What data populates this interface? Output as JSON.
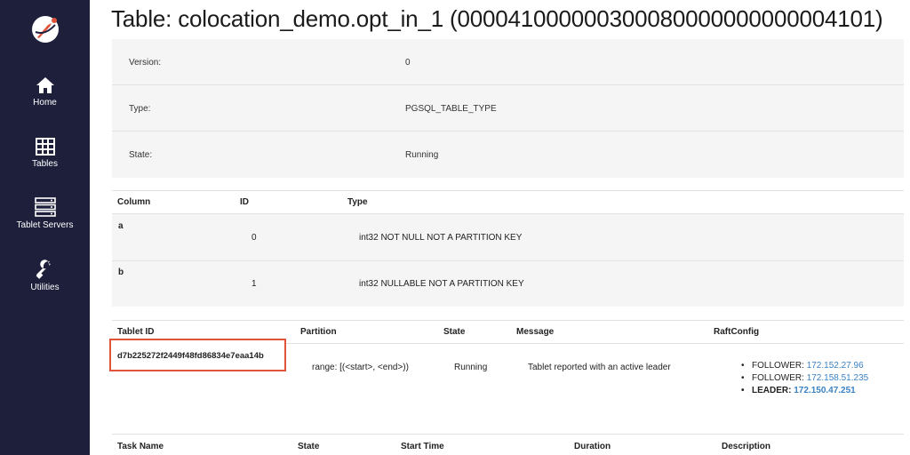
{
  "sidebar": {
    "logo_icon": "rocket-logo",
    "items": [
      {
        "label": "Home",
        "icon": "home-icon"
      },
      {
        "label": "Tables",
        "icon": "table-grid-icon"
      },
      {
        "label": "Tablet Servers",
        "icon": "server-rack-icon"
      },
      {
        "label": "Utilities",
        "icon": "wrench-icon"
      }
    ]
  },
  "page": {
    "title": "Table: colocation_demo.opt_in_1 (000041000000300080000000000004101)"
  },
  "info": [
    {
      "key": "Version:",
      "value": "0"
    },
    {
      "key": "Type:",
      "value": "PGSQL_TABLE_TYPE"
    },
    {
      "key": "State:",
      "value": "Running"
    }
  ],
  "columns_table": {
    "headers": [
      "Column",
      "ID",
      "Type"
    ],
    "rows": [
      {
        "column": "a",
        "id": "0",
        "type": "int32 NOT NULL NOT A PARTITION KEY"
      },
      {
        "column": "b",
        "id": "1",
        "type": "int32 NULLABLE NOT A PARTITION KEY"
      }
    ]
  },
  "tablets_table": {
    "headers": [
      "Tablet ID",
      "Partition",
      "State",
      "Message",
      "RaftConfig"
    ],
    "rows": [
      {
        "tablet_id": "d7b225272f2449f48fd86834e7eaa14b",
        "partition": "range: [(<start>, <end>))",
        "state": "Running",
        "message": "Tablet reported with an active leader",
        "raft": [
          {
            "role": "FOLLOWER:",
            "ip": "172.152.27.96"
          },
          {
            "role": "FOLLOWER:",
            "ip": "172.158.51.235"
          },
          {
            "role": "LEADER:",
            "ip": "172.150.47.251"
          }
        ]
      }
    ]
  },
  "tasks_table": {
    "headers": [
      "Task Name",
      "State",
      "Start Time",
      "Duration",
      "Description"
    ]
  },
  "colors": {
    "sidebar": "#1d1f3b",
    "highlight_border": "#e0553a",
    "link": "#3b82c4"
  }
}
